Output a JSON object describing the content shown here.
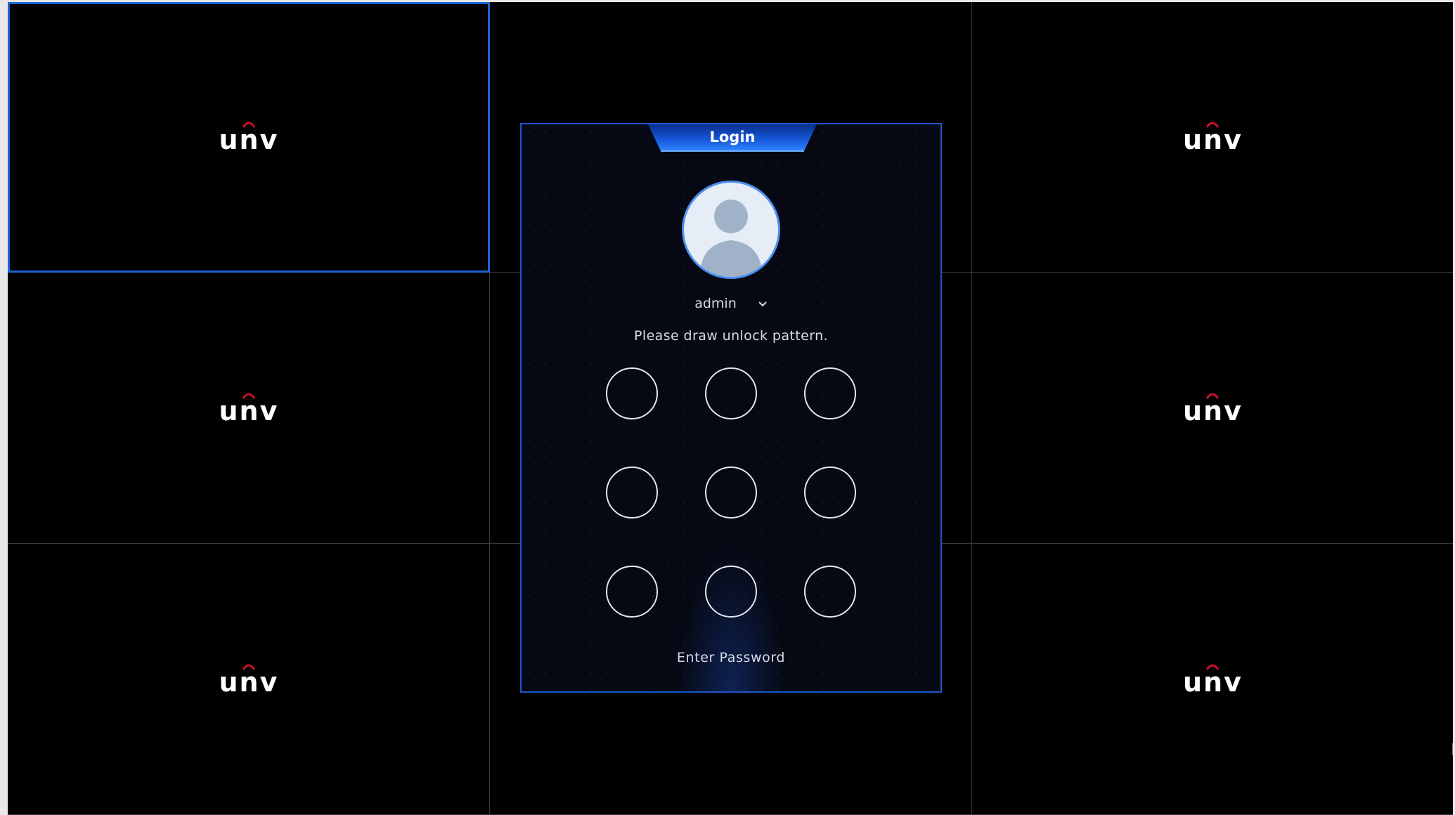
{
  "tiles": [
    {
      "id": 1,
      "logo": "unv"
    },
    {
      "id": 2,
      "logo": ""
    },
    {
      "id": 3,
      "logo": "unv"
    },
    {
      "id": 4,
      "logo": "unv"
    },
    {
      "id": 5,
      "logo": ""
    },
    {
      "id": 6,
      "logo": "unv"
    },
    {
      "id": 7,
      "logo": "unv"
    },
    {
      "id": 8,
      "logo": ""
    },
    {
      "id": 9,
      "logo": "unv"
    }
  ],
  "selected_tile": 1,
  "login": {
    "title": "Login",
    "username": "admin",
    "prompt": "Please draw unlock pattern.",
    "pattern_dots": 9,
    "enter_password_label": "Enter Password"
  },
  "colors": {
    "accent": "#1e63d6",
    "logo_arc": "#c8102e",
    "dialog_bg": "#060914"
  },
  "icons": [
    "user-avatar-icon",
    "chevron-down-icon",
    "mouse-cursor-icon"
  ]
}
